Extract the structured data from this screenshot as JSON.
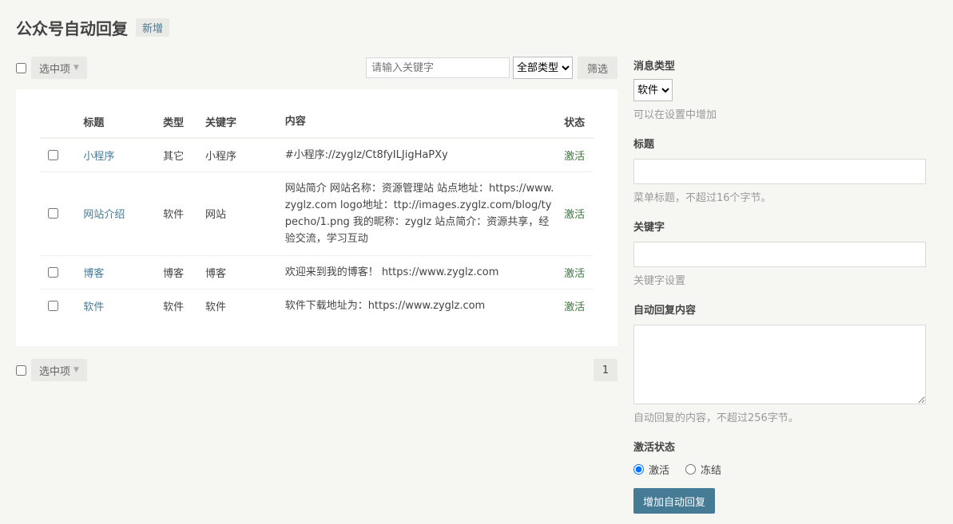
{
  "header": {
    "title": "公众号自动回复",
    "add_label": "新增"
  },
  "toolbar": {
    "select_label": "选中项",
    "search_placeholder": "请输入关键字",
    "type_filter_value": "全部类型",
    "filter_label": "筛选"
  },
  "table": {
    "columns": [
      "标题",
      "类型",
      "关键字",
      "内容",
      "状态"
    ],
    "rows": [
      {
        "title": "小程序",
        "type": "其它",
        "keyword": "小程序",
        "content": "#小程序://zyglz/Ct8fyILJigHaPXy",
        "status": "激活"
      },
      {
        "title": "网站介绍",
        "type": "软件",
        "keyword": "网站",
        "content": "网站简介 网站名称：资源管理站 站点地址：https://www.zyglz.com logo地址：ttp://images.zyglz.com/blog/typecho/1.png 我的昵称：zyglz 站点简介：资源共享，经验交流，学习互动",
        "status": "激活"
      },
      {
        "title": "博客",
        "type": "博客",
        "keyword": "博客",
        "content": "欢迎来到我的博客！ https://www.zyglz.com",
        "status": "激活"
      },
      {
        "title": "软件",
        "type": "软件",
        "keyword": "软件",
        "content": "软件下载地址为：https://www.zyglz.com",
        "status": "激活"
      }
    ]
  },
  "bottom": {
    "select_label": "选中项",
    "page": "1"
  },
  "form": {
    "msg_type_label": "消息类型",
    "msg_type_value": "软件",
    "msg_type_hint": "可以在设置中增加",
    "title_label": "标题",
    "title_hint": "菜单标题，不超过16个字节。",
    "keyword_label": "关键字",
    "keyword_hint": "关键字设置",
    "content_label": "自动回复内容",
    "content_hint": "自动回复的内容，不超过256字节。",
    "status_label": "激活状态",
    "status_active": "激活",
    "status_frozen": "冻结",
    "submit_label": "增加自动回复"
  },
  "colors": {
    "accent": "#467b96",
    "active_status": "#3c763d",
    "background": "#f6f6f3"
  }
}
